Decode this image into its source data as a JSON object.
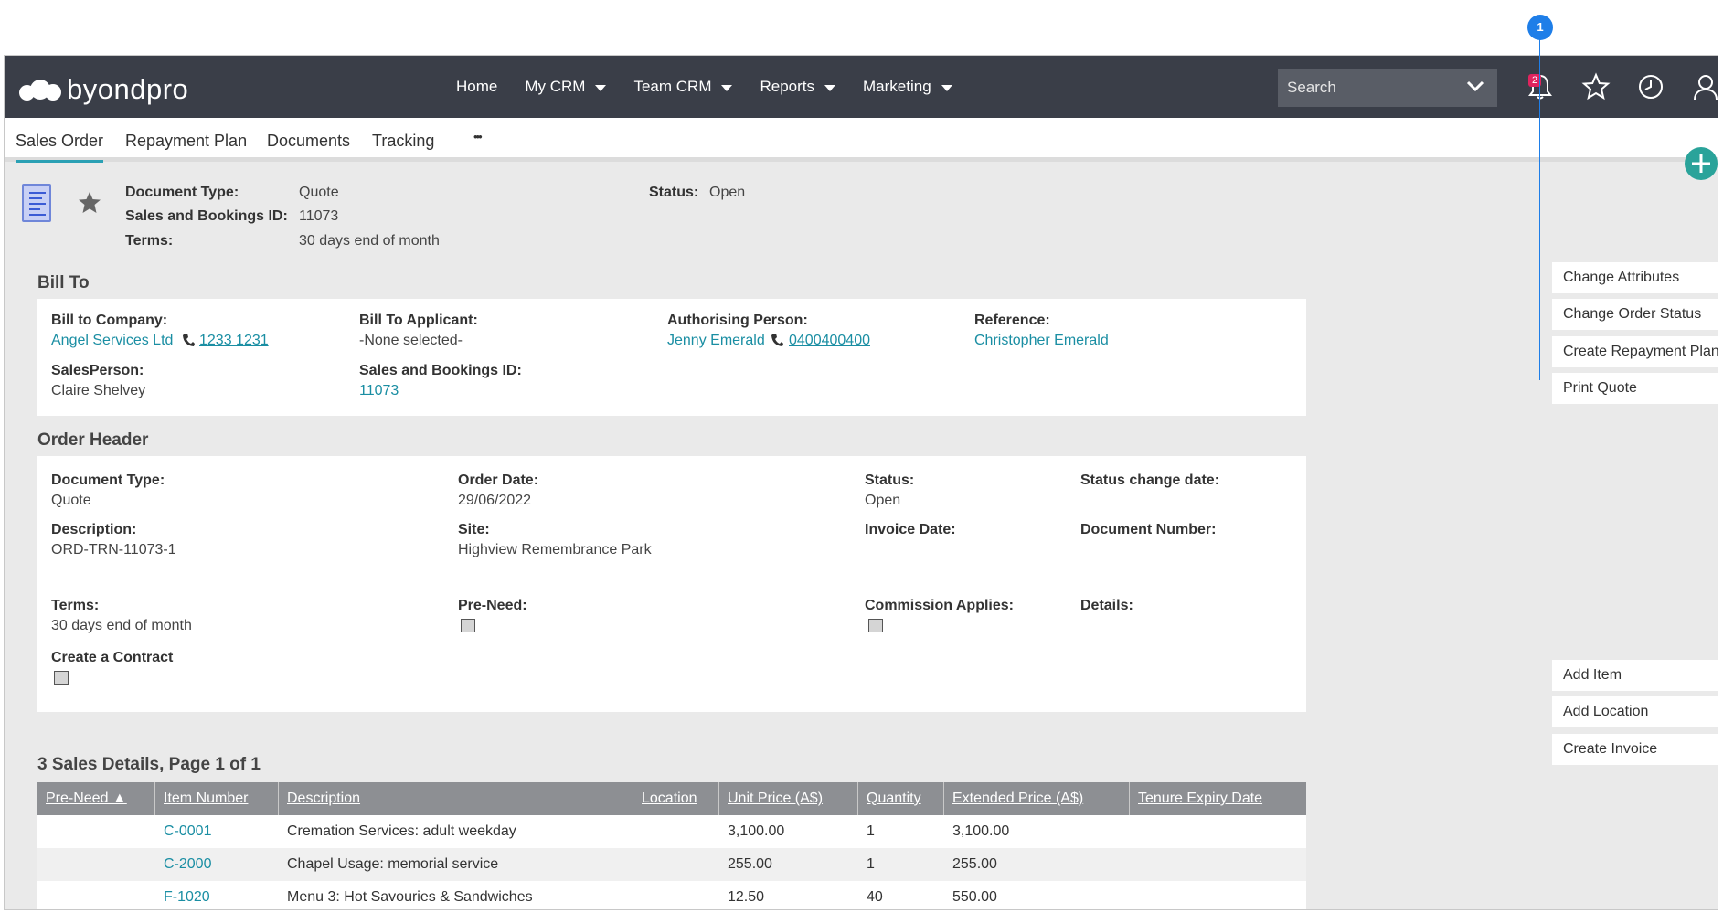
{
  "app": {
    "logo_text": "byondpro",
    "nav": [
      "Home",
      "My CRM",
      "Team CRM",
      "Reports",
      "Marketing"
    ],
    "search_placeholder": "Search",
    "notification_count": "2",
    "marker_label": "1"
  },
  "tabs": [
    "Sales Order",
    "Repayment Plan",
    "Documents",
    "Tracking",
    "•••"
  ],
  "summary": {
    "document_type_label": "Document Type:",
    "document_type": "Quote",
    "sb_id_label": "Sales and Bookings ID:",
    "sb_id": "11073",
    "terms_label": "Terms:",
    "terms": "30 days end of month",
    "status_label": "Status:",
    "status": "Open"
  },
  "bill_to": {
    "title": "Bill To",
    "company_label": "Bill to Company:",
    "company": "Angel Services Ltd",
    "company_phone": "1233 1231",
    "applicant_label": "Bill To Applicant:",
    "applicant": "-None selected-",
    "auth_label": "Authorising Person:",
    "auth_person": "Jenny Emerald",
    "auth_phone": "0400400400",
    "reference_label": "Reference:",
    "reference": "Christopher Emerald",
    "salesperson_label": "SalesPerson:",
    "salesperson": "Claire Shelvey",
    "sb_id_label": "Sales and Bookings ID:",
    "sb_id": "11073"
  },
  "order_header": {
    "title": "Order Header",
    "doc_type_label": "Document Type:",
    "doc_type": "Quote",
    "order_date_label": "Order Date:",
    "order_date": "29/06/2022",
    "status_label": "Status:",
    "status": "Open",
    "status_change_label": "Status change date:",
    "description_label": "Description:",
    "description": "ORD-TRN-11073-1",
    "site_label": "Site:",
    "site": "Highview Remembrance Park",
    "invoice_date_label": "Invoice Date:",
    "document_number_label": "Document Number:",
    "terms_label": "Terms:",
    "terms": "30 days end of month",
    "pre_need_label": "Pre-Need:",
    "commission_label": "Commission Applies:",
    "details_label": "Details:",
    "contract_label": "Create a Contract"
  },
  "actions": {
    "top": [
      "Change Attributes",
      "Change Order Status",
      "Create Repayment Plan",
      "Print Quote"
    ],
    "bottom": [
      "Add Item",
      "Add Location",
      "Create Invoice"
    ]
  },
  "sales_details": {
    "title": "3 Sales Details, Page 1 of 1",
    "columns": [
      "Pre-Need ▲",
      "Item Number",
      "Description",
      "Location",
      "Unit Price (A$)",
      "Quantity",
      "Extended Price (A$)",
      "Tenure Expiry Date"
    ],
    "rows": [
      {
        "item": "C-0001",
        "description": "Cremation Services: adult weekday",
        "unit_price": "3,100.00",
        "quantity": "1",
        "extended": "3,100.00"
      },
      {
        "item": "C-2000",
        "description": "Chapel Usage: memorial service",
        "unit_price": "255.00",
        "quantity": "1",
        "extended": "255.00"
      },
      {
        "item": "F-1020",
        "description": "Menu 3: Hot Savouries & Sandwiches",
        "unit_price": "12.50",
        "quantity": "40",
        "extended": "550.00"
      }
    ]
  }
}
